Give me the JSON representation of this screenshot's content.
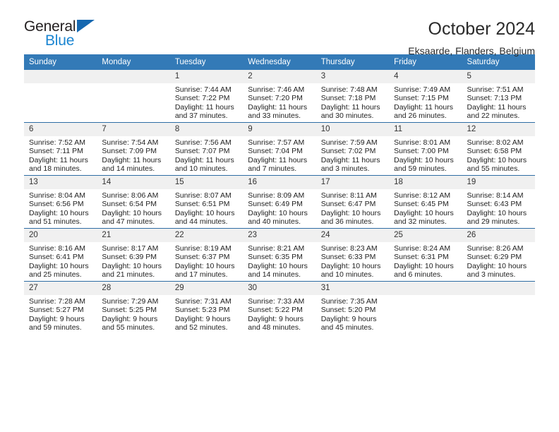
{
  "brand": {
    "name_top": "General",
    "name_bottom": "Blue",
    "triangle_icon": "brand-triangle-icon",
    "color_dark": "#231f20",
    "color_blue": "#1b85d1",
    "triangle_color": "#1668b0"
  },
  "header": {
    "title": "October 2024",
    "subtitle": "Eksaarde, Flanders, Belgium"
  },
  "theme": {
    "header_bg": "#337ab7",
    "row_divider": "#2e6da4",
    "daynum_bg": "#f0f0f0"
  },
  "weekdays": [
    "Sunday",
    "Monday",
    "Tuesday",
    "Wednesday",
    "Thursday",
    "Friday",
    "Saturday"
  ],
  "weeks": [
    [
      {
        "day": "",
        "sunrise": "",
        "sunset": "",
        "daylight_line1": "",
        "daylight_line2": ""
      },
      {
        "day": "",
        "sunrise": "",
        "sunset": "",
        "daylight_line1": "",
        "daylight_line2": ""
      },
      {
        "day": "1",
        "sunrise": "Sunrise: 7:44 AM",
        "sunset": "Sunset: 7:22 PM",
        "daylight_line1": "Daylight: 11 hours",
        "daylight_line2": "and 37 minutes."
      },
      {
        "day": "2",
        "sunrise": "Sunrise: 7:46 AM",
        "sunset": "Sunset: 7:20 PM",
        "daylight_line1": "Daylight: 11 hours",
        "daylight_line2": "and 33 minutes."
      },
      {
        "day": "3",
        "sunrise": "Sunrise: 7:48 AM",
        "sunset": "Sunset: 7:18 PM",
        "daylight_line1": "Daylight: 11 hours",
        "daylight_line2": "and 30 minutes."
      },
      {
        "day": "4",
        "sunrise": "Sunrise: 7:49 AM",
        "sunset": "Sunset: 7:15 PM",
        "daylight_line1": "Daylight: 11 hours",
        "daylight_line2": "and 26 minutes."
      },
      {
        "day": "5",
        "sunrise": "Sunrise: 7:51 AM",
        "sunset": "Sunset: 7:13 PM",
        "daylight_line1": "Daylight: 11 hours",
        "daylight_line2": "and 22 minutes."
      }
    ],
    [
      {
        "day": "6",
        "sunrise": "Sunrise: 7:52 AM",
        "sunset": "Sunset: 7:11 PM",
        "daylight_line1": "Daylight: 11 hours",
        "daylight_line2": "and 18 minutes."
      },
      {
        "day": "7",
        "sunrise": "Sunrise: 7:54 AM",
        "sunset": "Sunset: 7:09 PM",
        "daylight_line1": "Daylight: 11 hours",
        "daylight_line2": "and 14 minutes."
      },
      {
        "day": "8",
        "sunrise": "Sunrise: 7:56 AM",
        "sunset": "Sunset: 7:07 PM",
        "daylight_line1": "Daylight: 11 hours",
        "daylight_line2": "and 10 minutes."
      },
      {
        "day": "9",
        "sunrise": "Sunrise: 7:57 AM",
        "sunset": "Sunset: 7:04 PM",
        "daylight_line1": "Daylight: 11 hours",
        "daylight_line2": "and 7 minutes."
      },
      {
        "day": "10",
        "sunrise": "Sunrise: 7:59 AM",
        "sunset": "Sunset: 7:02 PM",
        "daylight_line1": "Daylight: 11 hours",
        "daylight_line2": "and 3 minutes."
      },
      {
        "day": "11",
        "sunrise": "Sunrise: 8:01 AM",
        "sunset": "Sunset: 7:00 PM",
        "daylight_line1": "Daylight: 10 hours",
        "daylight_line2": "and 59 minutes."
      },
      {
        "day": "12",
        "sunrise": "Sunrise: 8:02 AM",
        "sunset": "Sunset: 6:58 PM",
        "daylight_line1": "Daylight: 10 hours",
        "daylight_line2": "and 55 minutes."
      }
    ],
    [
      {
        "day": "13",
        "sunrise": "Sunrise: 8:04 AM",
        "sunset": "Sunset: 6:56 PM",
        "daylight_line1": "Daylight: 10 hours",
        "daylight_line2": "and 51 minutes."
      },
      {
        "day": "14",
        "sunrise": "Sunrise: 8:06 AM",
        "sunset": "Sunset: 6:54 PM",
        "daylight_line1": "Daylight: 10 hours",
        "daylight_line2": "and 47 minutes."
      },
      {
        "day": "15",
        "sunrise": "Sunrise: 8:07 AM",
        "sunset": "Sunset: 6:51 PM",
        "daylight_line1": "Daylight: 10 hours",
        "daylight_line2": "and 44 minutes."
      },
      {
        "day": "16",
        "sunrise": "Sunrise: 8:09 AM",
        "sunset": "Sunset: 6:49 PM",
        "daylight_line1": "Daylight: 10 hours",
        "daylight_line2": "and 40 minutes."
      },
      {
        "day": "17",
        "sunrise": "Sunrise: 8:11 AM",
        "sunset": "Sunset: 6:47 PM",
        "daylight_line1": "Daylight: 10 hours",
        "daylight_line2": "and 36 minutes."
      },
      {
        "day": "18",
        "sunrise": "Sunrise: 8:12 AM",
        "sunset": "Sunset: 6:45 PM",
        "daylight_line1": "Daylight: 10 hours",
        "daylight_line2": "and 32 minutes."
      },
      {
        "day": "19",
        "sunrise": "Sunrise: 8:14 AM",
        "sunset": "Sunset: 6:43 PM",
        "daylight_line1": "Daylight: 10 hours",
        "daylight_line2": "and 29 minutes."
      }
    ],
    [
      {
        "day": "20",
        "sunrise": "Sunrise: 8:16 AM",
        "sunset": "Sunset: 6:41 PM",
        "daylight_line1": "Daylight: 10 hours",
        "daylight_line2": "and 25 minutes."
      },
      {
        "day": "21",
        "sunrise": "Sunrise: 8:17 AM",
        "sunset": "Sunset: 6:39 PM",
        "daylight_line1": "Daylight: 10 hours",
        "daylight_line2": "and 21 minutes."
      },
      {
        "day": "22",
        "sunrise": "Sunrise: 8:19 AM",
        "sunset": "Sunset: 6:37 PM",
        "daylight_line1": "Daylight: 10 hours",
        "daylight_line2": "and 17 minutes."
      },
      {
        "day": "23",
        "sunrise": "Sunrise: 8:21 AM",
        "sunset": "Sunset: 6:35 PM",
        "daylight_line1": "Daylight: 10 hours",
        "daylight_line2": "and 14 minutes."
      },
      {
        "day": "24",
        "sunrise": "Sunrise: 8:23 AM",
        "sunset": "Sunset: 6:33 PM",
        "daylight_line1": "Daylight: 10 hours",
        "daylight_line2": "and 10 minutes."
      },
      {
        "day": "25",
        "sunrise": "Sunrise: 8:24 AM",
        "sunset": "Sunset: 6:31 PM",
        "daylight_line1": "Daylight: 10 hours",
        "daylight_line2": "and 6 minutes."
      },
      {
        "day": "26",
        "sunrise": "Sunrise: 8:26 AM",
        "sunset": "Sunset: 6:29 PM",
        "daylight_line1": "Daylight: 10 hours",
        "daylight_line2": "and 3 minutes."
      }
    ],
    [
      {
        "day": "27",
        "sunrise": "Sunrise: 7:28 AM",
        "sunset": "Sunset: 5:27 PM",
        "daylight_line1": "Daylight: 9 hours",
        "daylight_line2": "and 59 minutes."
      },
      {
        "day": "28",
        "sunrise": "Sunrise: 7:29 AM",
        "sunset": "Sunset: 5:25 PM",
        "daylight_line1": "Daylight: 9 hours",
        "daylight_line2": "and 55 minutes."
      },
      {
        "day": "29",
        "sunrise": "Sunrise: 7:31 AM",
        "sunset": "Sunset: 5:23 PM",
        "daylight_line1": "Daylight: 9 hours",
        "daylight_line2": "and 52 minutes."
      },
      {
        "day": "30",
        "sunrise": "Sunrise: 7:33 AM",
        "sunset": "Sunset: 5:22 PM",
        "daylight_line1": "Daylight: 9 hours",
        "daylight_line2": "and 48 minutes."
      },
      {
        "day": "31",
        "sunrise": "Sunrise: 7:35 AM",
        "sunset": "Sunset: 5:20 PM",
        "daylight_line1": "Daylight: 9 hours",
        "daylight_line2": "and 45 minutes."
      },
      {
        "day": "",
        "sunrise": "",
        "sunset": "",
        "daylight_line1": "",
        "daylight_line2": ""
      },
      {
        "day": "",
        "sunrise": "",
        "sunset": "",
        "daylight_line1": "",
        "daylight_line2": ""
      }
    ]
  ]
}
